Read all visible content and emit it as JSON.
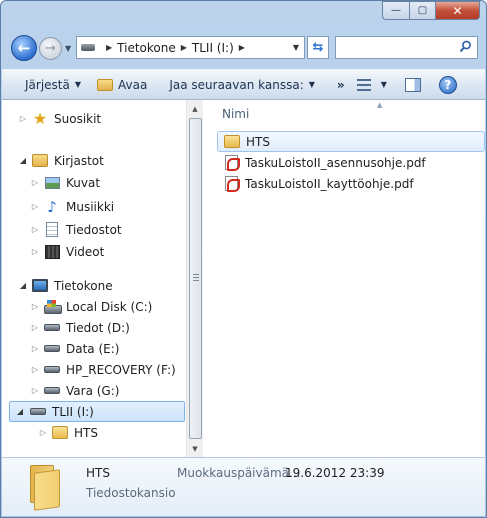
{
  "window": {
    "caption_minimize": "—",
    "caption_maximize": "▢",
    "caption_close": "✕"
  },
  "address_bar": {
    "crumbs": [
      "Tietokone",
      "TLII (I:)"
    ],
    "search_placeholder": ""
  },
  "toolbar": {
    "organize": "Järjestä",
    "open": "Avaa",
    "share": "Jaa seuraavan kanssa:",
    "more": "»",
    "help": "?"
  },
  "nav_tree": {
    "favorites": "Suosikit",
    "libraries": "Kirjastot",
    "library_items": [
      "Kuvat",
      "Musiikki",
      "Tiedostot",
      "Videot"
    ],
    "computer": "Tietokone",
    "drives": [
      "Local Disk (C:)",
      "Tiedot (D:)",
      "Data (E:)",
      "HP_RECOVERY (F:)",
      "Vara (G:)",
      "TLII (I:)"
    ],
    "selected_subfolder": "HTS"
  },
  "file_list": {
    "column_name": "Nimi",
    "items": [
      {
        "name": "HTS",
        "icon": "folder-icon"
      },
      {
        "name": "TaskuLoistoII_asennusohje.pdf",
        "icon": "pdf-icon"
      },
      {
        "name": "TaskuLoistoII_kayttöohje.pdf",
        "icon": "pdf-icon"
      }
    ]
  },
  "details": {
    "name": "HTS",
    "type": "Tiedostokansio",
    "modified_label": "Muokkauspäivämä...",
    "modified_value": "19.6.2012 23:39"
  },
  "colors": {
    "selection_border": "#7eb4ea",
    "close_red": "#c3503a",
    "link_blue": "#2e6fd0"
  }
}
